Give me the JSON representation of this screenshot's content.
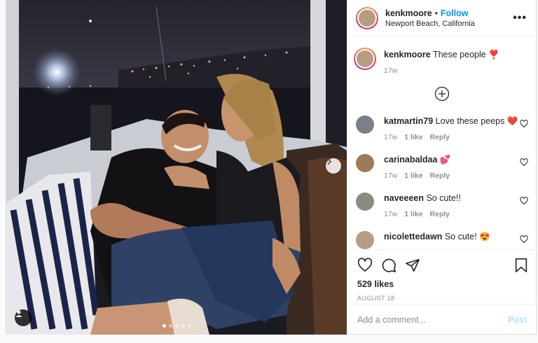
{
  "header": {
    "username": "kenkmoore",
    "separator": "•",
    "follow_label": "Follow",
    "location": "Newport Beach, California",
    "more_label": "•••"
  },
  "caption": {
    "username": "kenkmoore",
    "text": "These people ❣️",
    "time": "17w"
  },
  "comments": [
    {
      "username": "katmartin79",
      "text": "Love these peeps ❤️",
      "time": "17w",
      "likes": "1 like",
      "reply": "Reply"
    },
    {
      "username": "carinabaldaa",
      "text": "💕",
      "time": "17w",
      "likes": "1 like",
      "reply": "Reply"
    },
    {
      "username": "naveeeen",
      "text": "So cute!!",
      "time": "17w",
      "likes": "1 like",
      "reply": "Reply"
    },
    {
      "username": "nicolettedawn",
      "text": "So cute! 😍",
      "time": "",
      "likes": "",
      "reply": ""
    }
  ],
  "stats": {
    "likes": "529 likes",
    "date": "AUGUST 18"
  },
  "add_comment": {
    "placeholder": "Add a comment...",
    "post_label": "Post"
  },
  "carousel": {
    "slide_count": 5,
    "active_index": 0
  },
  "icons": {
    "like": "heart-icon",
    "comment": "comment-icon",
    "share": "share-icon",
    "save": "bookmark-icon",
    "load_more": "plus-circle-icon",
    "next": "chevron-right-icon",
    "tags": "user-tag-icon"
  },
  "colors": {
    "follow": "#0095f6",
    "post_disabled": "#b2dffc",
    "muted": "#8e8e8e"
  }
}
